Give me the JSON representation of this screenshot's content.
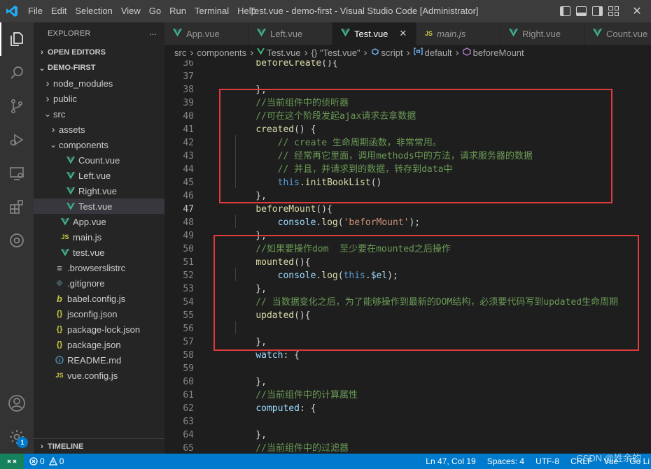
{
  "window": {
    "title": "Test.vue - demo-first - Visual Studio Code [Administrator]"
  },
  "menu": [
    "File",
    "Edit",
    "Selection",
    "View",
    "Go",
    "Run",
    "Terminal",
    "Help"
  ],
  "sidebar": {
    "title": "EXPLORER",
    "more": "···",
    "open_editors": "OPEN EDITORS",
    "project": "DEMO-FIRST",
    "timeline": "TIMELINE",
    "tree": [
      {
        "label": "node_modules",
        "icon": "chevron-right-icon",
        "indent": 0
      },
      {
        "label": "public",
        "icon": "chevron-right-icon",
        "indent": 0
      },
      {
        "label": "src",
        "icon": "chevron-down-icon",
        "indent": 0
      },
      {
        "label": "assets",
        "icon": "chevron-right-icon",
        "indent": 1
      },
      {
        "label": "components",
        "icon": "chevron-down-icon",
        "indent": 1
      },
      {
        "label": "Count.vue",
        "icon": "vue-icon",
        "indent": 2
      },
      {
        "label": "Left.vue",
        "icon": "vue-icon",
        "indent": 2
      },
      {
        "label": "Right.vue",
        "icon": "vue-icon",
        "indent": 2
      },
      {
        "label": "Test.vue",
        "icon": "vue-icon",
        "indent": 2,
        "selected": true
      },
      {
        "label": "App.vue",
        "icon": "vue-icon",
        "indent": 1
      },
      {
        "label": "main.js",
        "icon": "js-icon",
        "indent": 1
      },
      {
        "label": "test.vue",
        "icon": "vue-icon",
        "indent": 1
      },
      {
        "label": ".browserslistrc",
        "icon": "list-icon",
        "indent": 0
      },
      {
        "label": ".gitignore",
        "icon": "git-icon",
        "indent": 0
      },
      {
        "label": "babel.config.js",
        "icon": "babel-icon",
        "indent": 0
      },
      {
        "label": "jsconfig.json",
        "icon": "json-icon",
        "indent": 0
      },
      {
        "label": "package-lock.json",
        "icon": "json-icon",
        "indent": 0
      },
      {
        "label": "package.json",
        "icon": "json-icon",
        "indent": 0
      },
      {
        "label": "README.md",
        "icon": "info-icon",
        "indent": 0
      },
      {
        "label": "vue.config.js",
        "icon": "js-icon",
        "indent": 0
      }
    ]
  },
  "tabs": [
    {
      "label": "App.vue",
      "icon": "vue-icon"
    },
    {
      "label": "Left.vue",
      "icon": "vue-icon"
    },
    {
      "label": "Test.vue",
      "icon": "vue-icon",
      "active": true,
      "close": "✕"
    },
    {
      "label": "main.js",
      "icon": "js-icon",
      "italic": true
    },
    {
      "label": "Right.vue",
      "icon": "vue-icon"
    },
    {
      "label": "Count.vue",
      "icon": "vue-icon"
    }
  ],
  "breadcrumb": [
    "src",
    "components",
    "Test.vue",
    "{} \"Test.vue\"",
    "script",
    "default",
    "beforeMount"
  ],
  "editor": {
    "lines": [
      {
        "n": "36",
        "t": [
          [
            "    ",
            ""
          ],
          [
            "beforeCreate",
            "fn"
          ],
          [
            "(){",
            "pun"
          ]
        ]
      },
      {
        "n": "37",
        "t": []
      },
      {
        "n": "38",
        "t": [
          [
            "    },",
            "pun"
          ]
        ]
      },
      {
        "n": "39",
        "t": [
          [
            "    //当前组件中的侦听器",
            "cmt"
          ]
        ]
      },
      {
        "n": "40",
        "t": [
          [
            "    //可在这个阶段发起ajax请求去拿数据",
            "cmt"
          ]
        ]
      },
      {
        "n": "41",
        "t": [
          [
            "    ",
            ""
          ],
          [
            "created",
            "fn"
          ],
          [
            "() {",
            "pun"
          ]
        ]
      },
      {
        "n": "42",
        "t": [
          [
            "        // create 生命周期函数，非常常用。",
            "cmt"
          ]
        ]
      },
      {
        "n": "43",
        "t": [
          [
            "        // 经常再它里面，调用methods中的方法，请求服务器的数据",
            "cmt"
          ]
        ]
      },
      {
        "n": "44",
        "t": [
          [
            "        // 并且，并请求到的数据，转存到data中",
            "cmt"
          ]
        ]
      },
      {
        "n": "45",
        "t": [
          [
            "        ",
            ""
          ],
          [
            "this",
            "kw"
          ],
          [
            ".",
            "pun"
          ],
          [
            "initBookList",
            "fn"
          ],
          [
            "()",
            "pun"
          ]
        ]
      },
      {
        "n": "46",
        "t": [
          [
            "    },",
            "pun"
          ]
        ]
      },
      {
        "n": "47",
        "t": [
          [
            "    ",
            ""
          ],
          [
            "beforeMount",
            "fn"
          ],
          [
            "(){",
            "pun"
          ]
        ],
        "current": true
      },
      {
        "n": "48",
        "t": [
          [
            "        ",
            ""
          ],
          [
            "console",
            "var"
          ],
          [
            ".",
            "pun"
          ],
          [
            "log",
            "fn"
          ],
          [
            "(",
            "pun"
          ],
          [
            "'beforMount'",
            "str"
          ],
          [
            ");",
            "pun"
          ]
        ]
      },
      {
        "n": "49",
        "t": [
          [
            "    },",
            "pun"
          ]
        ]
      },
      {
        "n": "50",
        "t": [
          [
            "    //如果要操作dom  至少要在mounted之后操作",
            "cmt"
          ]
        ]
      },
      {
        "n": "51",
        "t": [
          [
            "    ",
            ""
          ],
          [
            "mounted",
            "fn"
          ],
          [
            "(){",
            "pun"
          ]
        ]
      },
      {
        "n": "52",
        "t": [
          [
            "        ",
            ""
          ],
          [
            "console",
            "var"
          ],
          [
            ".",
            "pun"
          ],
          [
            "log",
            "fn"
          ],
          [
            "(",
            "pun"
          ],
          [
            "this",
            "kw"
          ],
          [
            ".",
            "pun"
          ],
          [
            "$el",
            "var"
          ],
          [
            ");",
            "pun"
          ]
        ]
      },
      {
        "n": "53",
        "t": [
          [
            "    },",
            "pun"
          ]
        ]
      },
      {
        "n": "54",
        "t": [
          [
            "    // 当数据变化之后，为了能够操作到最新的DOM结构，必须要代码写到updated生命周期",
            "cmt"
          ]
        ]
      },
      {
        "n": "55",
        "t": [
          [
            "    ",
            ""
          ],
          [
            "updated",
            "fn"
          ],
          [
            "(){",
            "pun"
          ]
        ]
      },
      {
        "n": "56",
        "t": []
      },
      {
        "n": "57",
        "t": [
          [
            "    },",
            "pun"
          ]
        ]
      },
      {
        "n": "58",
        "t": [
          [
            "    ",
            ""
          ],
          [
            "watch",
            "var"
          ],
          [
            ": {",
            "pun"
          ]
        ]
      },
      {
        "n": "59",
        "t": []
      },
      {
        "n": "60",
        "t": [
          [
            "    },",
            "pun"
          ]
        ]
      },
      {
        "n": "61",
        "t": [
          [
            "    //当前组件中的计算属性",
            "cmt"
          ]
        ]
      },
      {
        "n": "62",
        "t": [
          [
            "    ",
            ""
          ],
          [
            "computed",
            "var"
          ],
          [
            ": {",
            "pun"
          ]
        ]
      },
      {
        "n": "63",
        "t": []
      },
      {
        "n": "64",
        "t": [
          [
            "    },",
            "pun"
          ]
        ]
      },
      {
        "n": "65",
        "t": [
          [
            "    //当前组件中的过滤器",
            "cmt"
          ]
        ]
      }
    ]
  },
  "statusbar": {
    "errors": "0",
    "warnings": "0",
    "position": "Ln 47, Col 19",
    "spaces": "Spaces: 4",
    "encoding": "UTF-8",
    "eol": "CRLF",
    "language": "Vue",
    "golive": "Go Li",
    "watermark": "CSDN @姓余的"
  },
  "accounts_badge": "1",
  "colors": {
    "accent": "#007acc",
    "highlight_box": "#e0393e",
    "vue": "#41b883"
  }
}
